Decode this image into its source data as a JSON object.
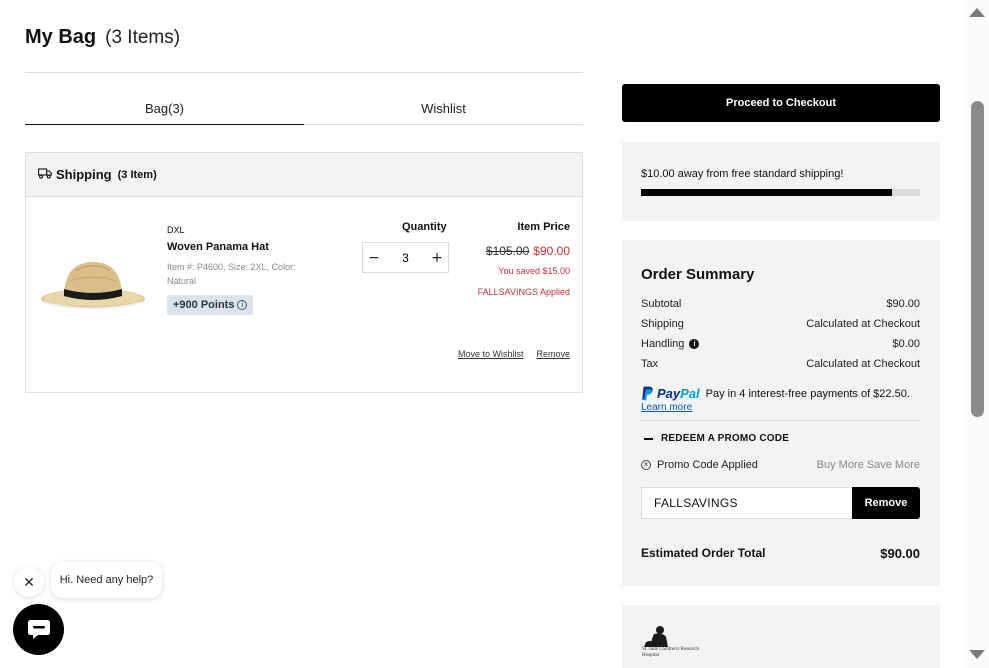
{
  "header": {
    "title": "My Bag",
    "count": "(3 Items)"
  },
  "tabs": [
    {
      "label": "Bag(3)",
      "active": true
    },
    {
      "label": "Wishlist",
      "active": false
    }
  ],
  "shipping": {
    "label": "Shipping",
    "count": "(3 Item)",
    "icon": "truck-icon",
    "item": {
      "brand": "DXL",
      "name": "Woven Panama Hat",
      "meta": "Item #: P4600, Size: 2XL, Color: Natural",
      "points": "+900 Points",
      "quantity_label": "Quantity",
      "quantity": "3",
      "price_label": "Item Price",
      "old_price": "$105.00",
      "new_price": "$90.00",
      "saved": "You saved $15.00",
      "promo_applied": "FALLSAVINGS Applied",
      "move_to_wishlist": "Move to Wishlist",
      "remove": "Remove"
    }
  },
  "checkout_button": "Proceed to Checkout",
  "shipping_progress": {
    "message": "$10.00 away from free standard shipping!",
    "progress": 0.9
  },
  "order_summary": {
    "title": "Order Summary",
    "rows": [
      {
        "label": "Subtotal",
        "value": "$90.00"
      },
      {
        "label": "Shipping",
        "value": "Calculated at Checkout"
      },
      {
        "label": "Handling",
        "value": "$0.00"
      },
      {
        "label": "Tax",
        "value": "Calculated at Checkout"
      }
    ],
    "paypal": {
      "brand_a": "Pay",
      "brand_b": "Pal",
      "text": "Pay in 4 interest-free payments of $22.50.",
      "learn_more": "Learn more"
    },
    "redeem_label": "REDEEM A PROMO CODE",
    "promo_status": "Promo Code Applied",
    "promo_hint": "Buy More Save More",
    "promo_code": "FALLSAVINGS",
    "promo_remove": "Remove",
    "total_label": "Estimated Order Total",
    "total_value": "$90.00"
  },
  "charity_logo_text": "St. Jude Children's Research Hospital",
  "chat": {
    "message": "Hi. Need any help?"
  },
  "colors": {
    "accent_red": "#c1323b",
    "panel_bg": "#f2f3f3",
    "paypal_dark": "#003087",
    "paypal_light": "#009cde",
    "link_blue": "#0b58a8"
  }
}
